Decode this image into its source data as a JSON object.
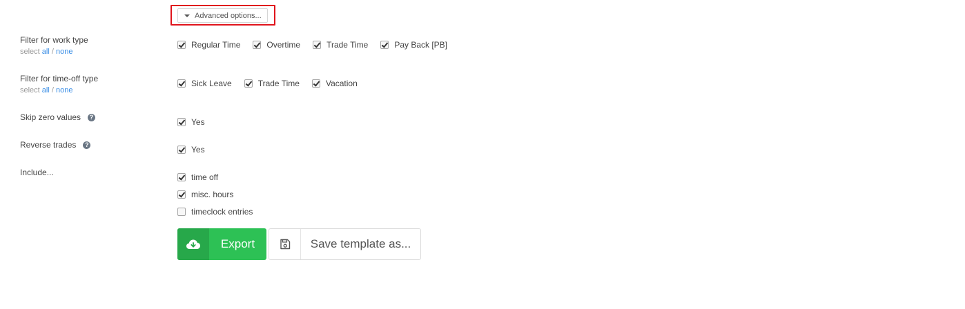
{
  "advanced_options": {
    "label": "Advanced options..."
  },
  "work_type": {
    "label": "Filter for work type",
    "select_prefix": "select ",
    "select_all": "all",
    "select_sep": " / ",
    "select_none": "none",
    "options": [
      {
        "label": "Regular Time",
        "checked": true
      },
      {
        "label": "Overtime",
        "checked": true
      },
      {
        "label": "Trade Time",
        "checked": true
      },
      {
        "label": "Pay Back [PB]",
        "checked": true
      }
    ]
  },
  "timeoff_type": {
    "label": "Filter for time-off type",
    "select_prefix": "select ",
    "select_all": "all",
    "select_sep": " / ",
    "select_none": "none",
    "options": [
      {
        "label": "Sick Leave",
        "checked": true
      },
      {
        "label": "Trade Time",
        "checked": true
      },
      {
        "label": "Vacation",
        "checked": true
      }
    ]
  },
  "skip_zero": {
    "label": "Skip zero values",
    "help": "?",
    "option": {
      "label": "Yes",
      "checked": true
    }
  },
  "reverse_trades": {
    "label": "Reverse trades",
    "help": "?",
    "option": {
      "label": "Yes",
      "checked": true
    }
  },
  "include": {
    "label": "Include...",
    "options": [
      {
        "label": "time off",
        "checked": true
      },
      {
        "label": "misc. hours",
        "checked": true
      },
      {
        "label": "timeclock entries",
        "checked": false
      }
    ]
  },
  "actions": {
    "export_label": "Export",
    "export_icon": "cloud-download-icon",
    "save_label": "Save template as...",
    "save_icon": "floppy-disk-icon"
  },
  "colors": {
    "accent_green": "#2dc155",
    "accent_green_dark": "#27a84a",
    "link": "#3a8ee6",
    "highlight": "#e0131b"
  }
}
